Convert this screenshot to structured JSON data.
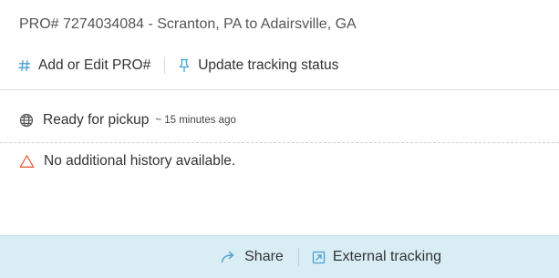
{
  "shipment": {
    "title": "PRO# 7274034084 - Scranton, PA to Adairsville, GA"
  },
  "actions": {
    "edit_pro": {
      "icon": "hash-icon",
      "label": "Add or Edit PRO#"
    },
    "update_status": {
      "icon": "pin-icon",
      "label": "Update tracking status"
    }
  },
  "tracking": {
    "status": {
      "icon": "globe-icon",
      "label": "Ready for pickup",
      "time": "~ 15 minutes ago"
    },
    "history": {
      "icon": "warning-icon",
      "message": "No additional history available."
    }
  },
  "footer": {
    "share": {
      "icon": "share-arrow-icon",
      "label": "Share"
    },
    "external": {
      "icon": "external-link-icon",
      "label": "External tracking"
    }
  },
  "colors": {
    "accent": "#4a9fd1",
    "warning": "#e8623a",
    "footer_bg": "#d9edf5"
  }
}
